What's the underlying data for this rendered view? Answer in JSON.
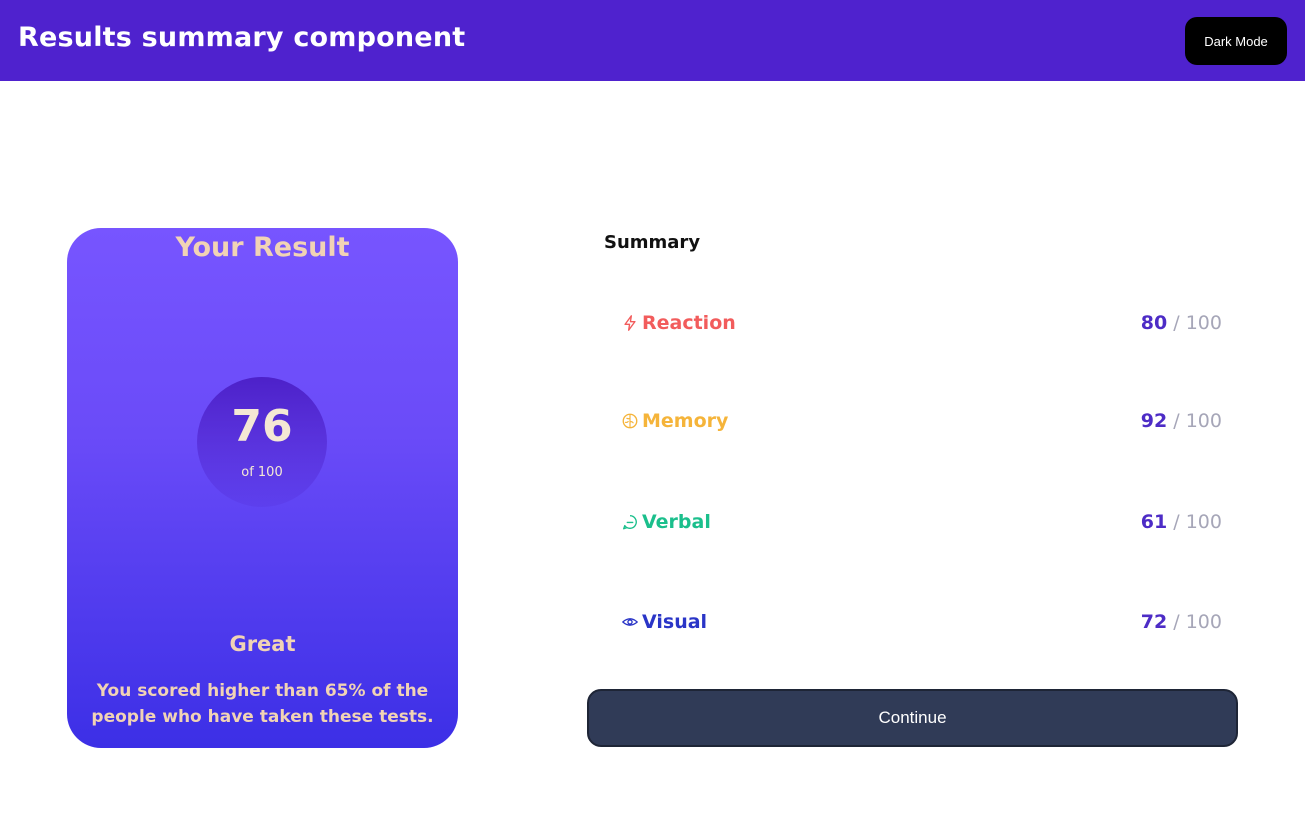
{
  "header": {
    "title": "Results summary component",
    "dark_mode_label": "Dark Mode"
  },
  "result": {
    "heading": "Your Result",
    "score": "76",
    "out_of": "of 100",
    "rating": "Great",
    "description": "You scored higher than 65% of the people who have taken these tests."
  },
  "summary": {
    "title": "Summary",
    "items": [
      {
        "label": "Reaction",
        "score": "80",
        "total": "/ 100",
        "icon": "lightning-icon",
        "color": "#f25c5c"
      },
      {
        "label": "Memory",
        "score": "92",
        "total": "/ 100",
        "icon": "brain-icon",
        "color": "#f5b43a"
      },
      {
        "label": "Verbal",
        "score": "61",
        "total": "/ 100",
        "icon": "chat-bubble-icon",
        "color": "#1bbf8c"
      },
      {
        "label": "Visual",
        "score": "72",
        "total": "/ 100",
        "icon": "eye-icon",
        "color": "#2a35c7"
      }
    ],
    "continue_label": "Continue"
  },
  "colors": {
    "header_bg": "#4f22ce",
    "card_gradient_top": "#7755ff",
    "card_gradient_bottom": "#3c2fe6",
    "accent_text": "#f1d3b5",
    "score_value": "#4d2cc6",
    "button_bg": "#303b57"
  }
}
